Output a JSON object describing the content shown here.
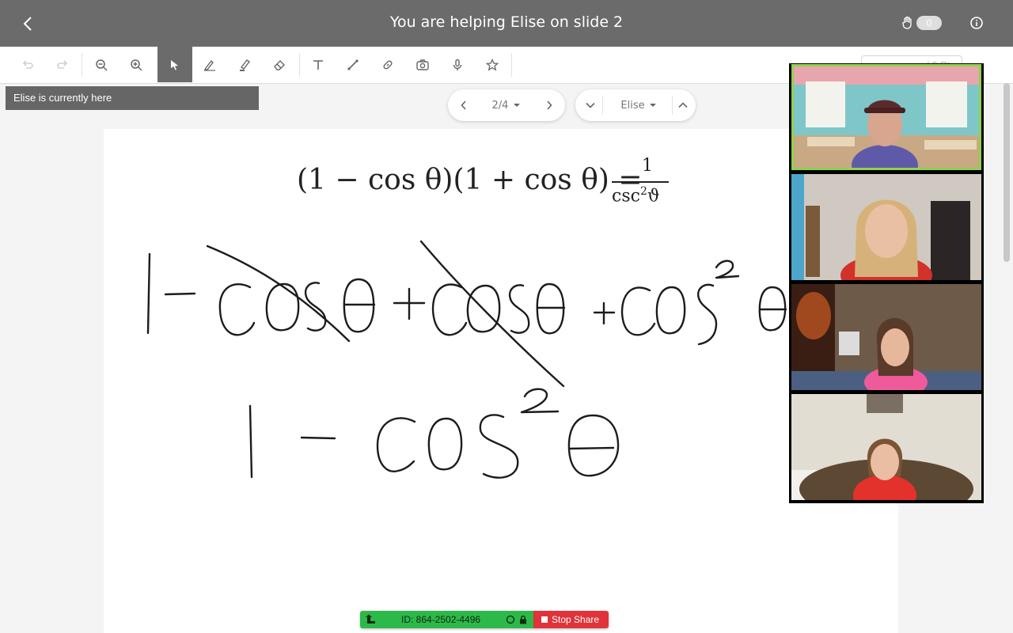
{
  "header": {
    "title": "You are helping Elise on slide 2",
    "hand_count": "0"
  },
  "toolbar": {
    "tools": [
      "undo-icon",
      "redo-icon",
      "zoom-out-icon",
      "zoom-in-icon",
      "select-icon",
      "pen-icon",
      "highlighter-icon",
      "eraser-icon",
      "text-icon",
      "line-icon",
      "link-icon",
      "camera-icon",
      "microphone-icon",
      "star-icon"
    ],
    "active_tool": "select",
    "points_text": "/ 0 Pts"
  },
  "status": {
    "location_banner": "Elise is currently here"
  },
  "slide_nav": {
    "page_label": "2/4",
    "student_label": "Elise"
  },
  "slide": {
    "equation_lhs": "(1 − cos θ)(1 + cos θ) =",
    "equation_numerator": "1",
    "equation_denominator": "csc",
    "equation_denominator_exp": "2",
    "equation_denominator_var": "ϑ"
  },
  "video_panel": {
    "participants": [
      "participant-1",
      "participant-2",
      "participant-3",
      "participant-4"
    ]
  },
  "share_bar": {
    "meeting_id": "ID: 864-2502-4496",
    "stop_label": "Stop Share"
  },
  "colors": {
    "topbar": "#6b6b6b",
    "share_green": "#2db84a",
    "stop_red": "#e0333a",
    "speaker_outline": "#8fd14f"
  }
}
